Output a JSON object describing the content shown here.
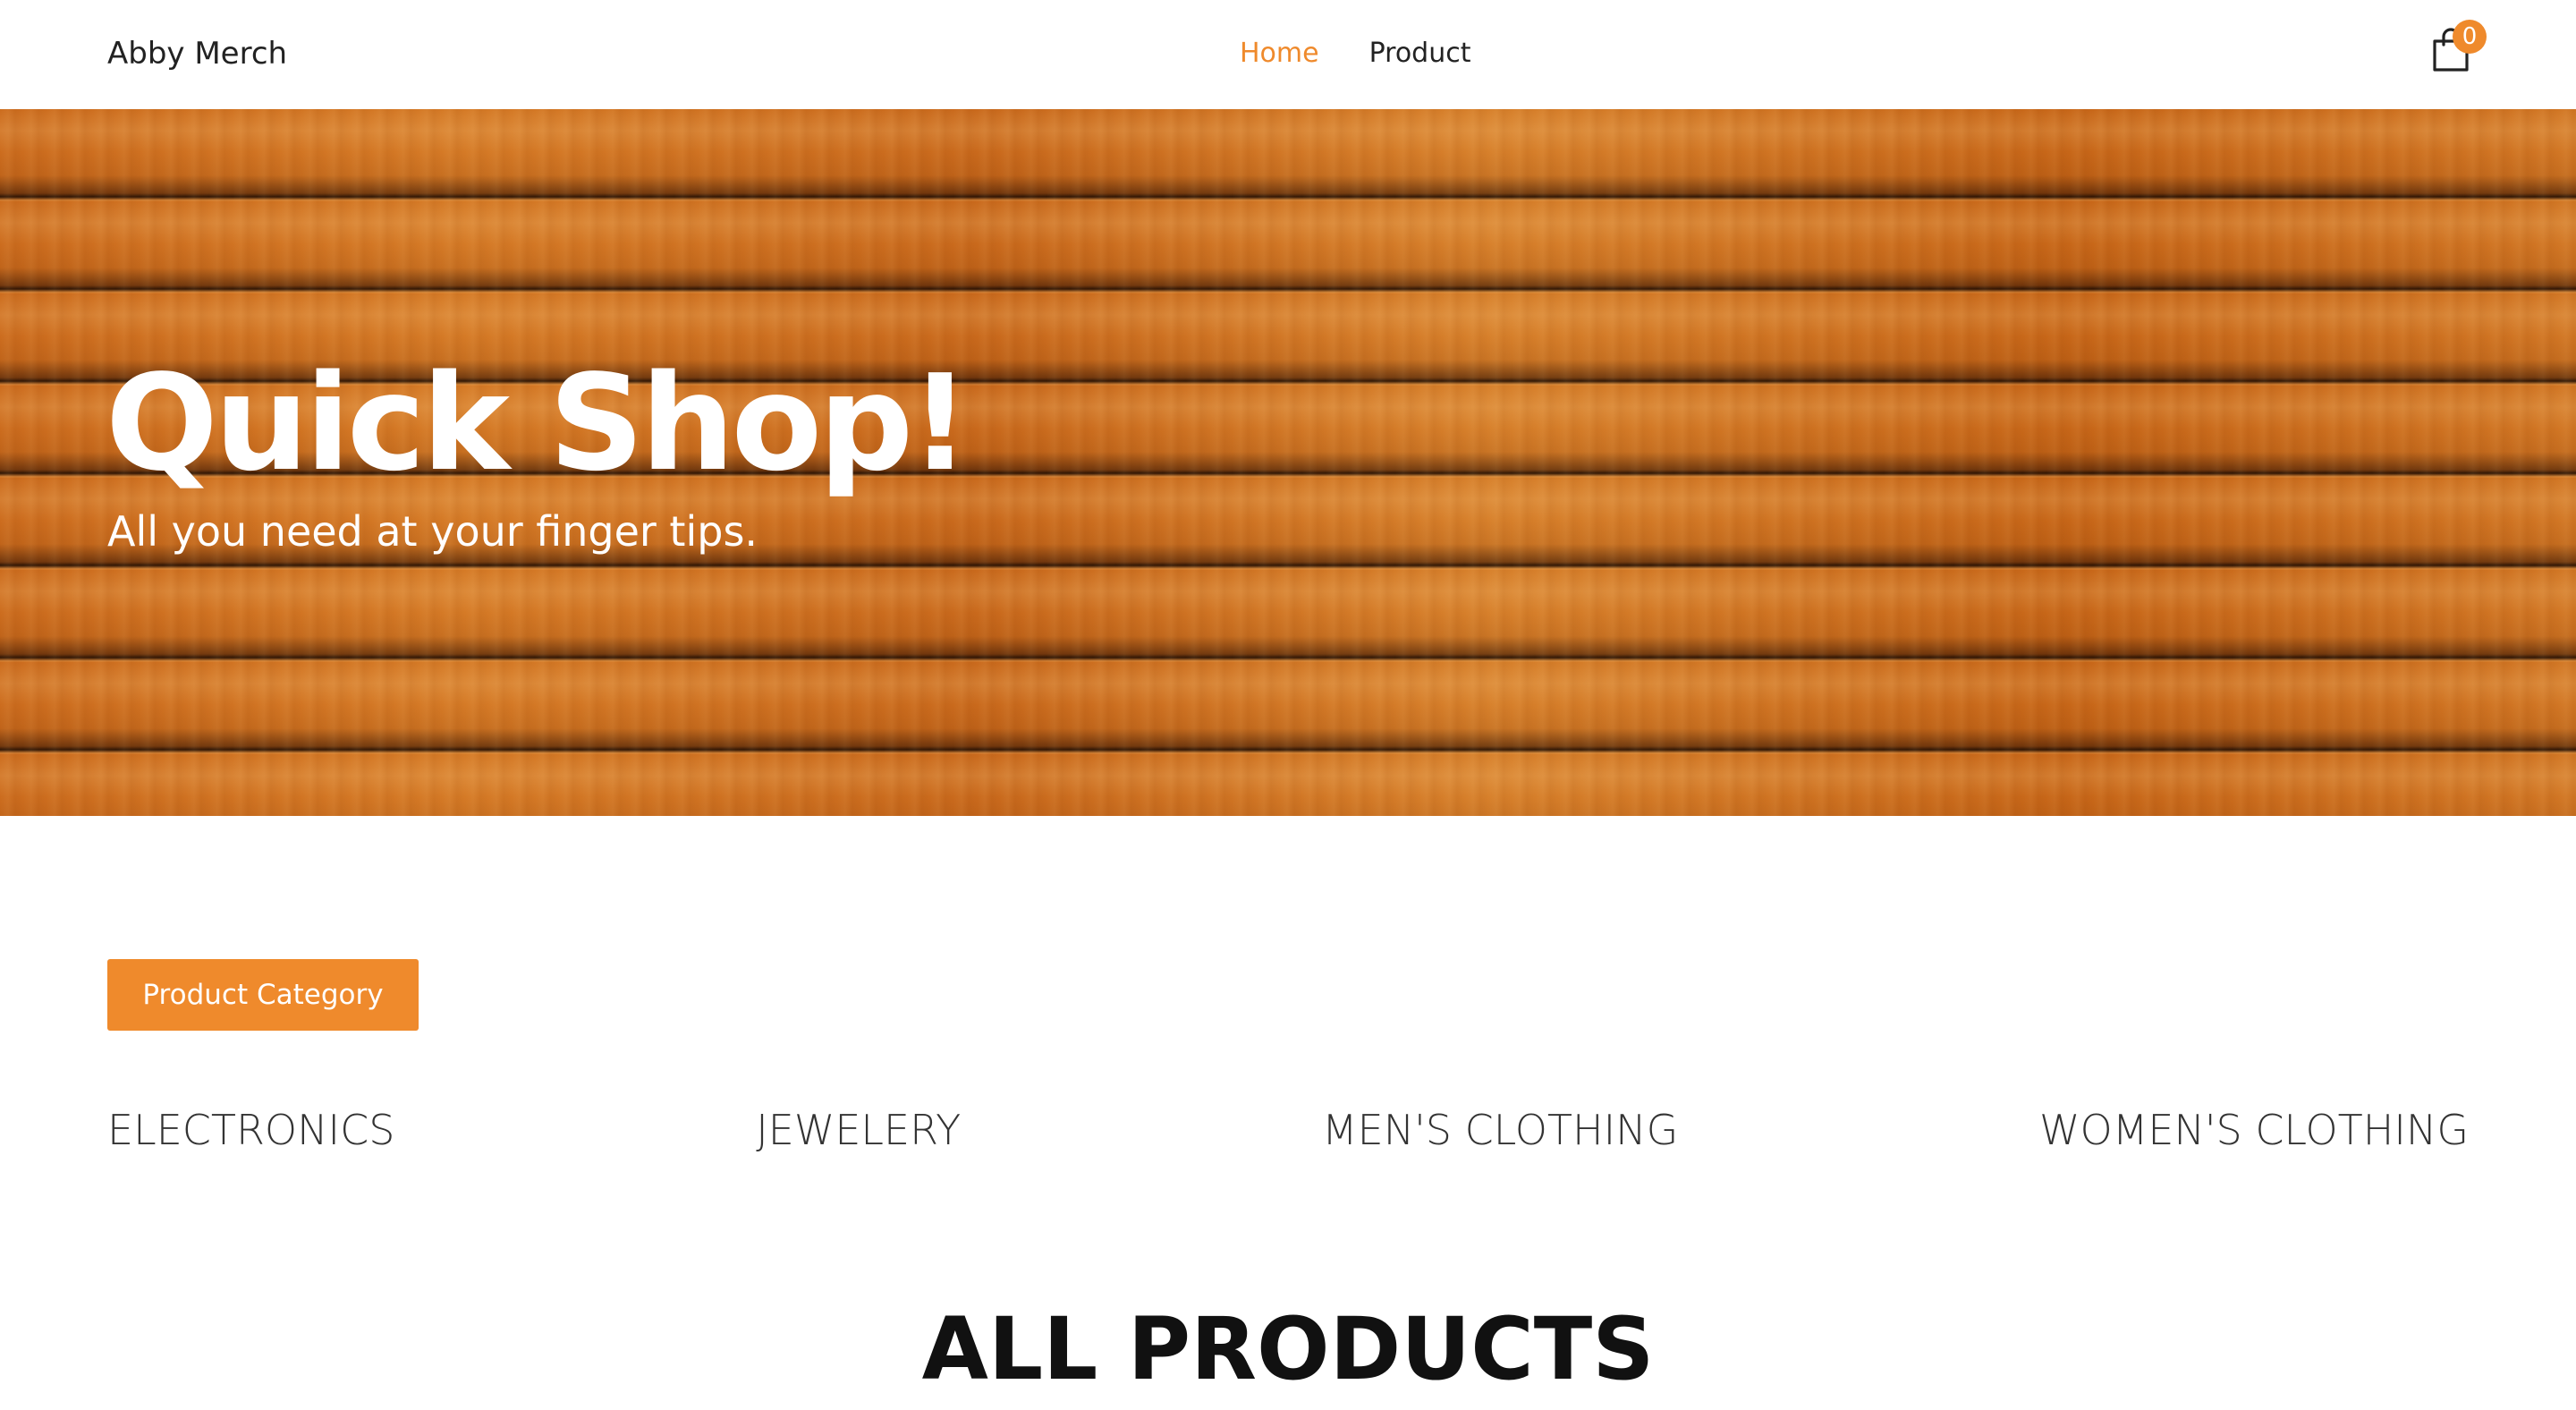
{
  "header": {
    "brand": "Abby Merch",
    "nav": [
      {
        "label": "Home",
        "active": true
      },
      {
        "label": "Product",
        "active": false
      }
    ],
    "cart": {
      "icon": "shopping-bag-icon",
      "count": "0"
    }
  },
  "hero": {
    "title": "Quick Shop!",
    "subtitle": "All you need at your finger tips."
  },
  "categories": {
    "button_label": "Product Category",
    "items": [
      {
        "label": "ELECTRONICS"
      },
      {
        "label": "JEWELERY"
      },
      {
        "label": "MEN'S CLOTHING"
      },
      {
        "label": "WOMEN'S CLOTHING"
      }
    ]
  },
  "products": {
    "heading": "ALL PRODUCTS"
  },
  "theme": {
    "accent": "#ef8a2c",
    "text": "#222222",
    "hero_text": "#ffffff"
  }
}
